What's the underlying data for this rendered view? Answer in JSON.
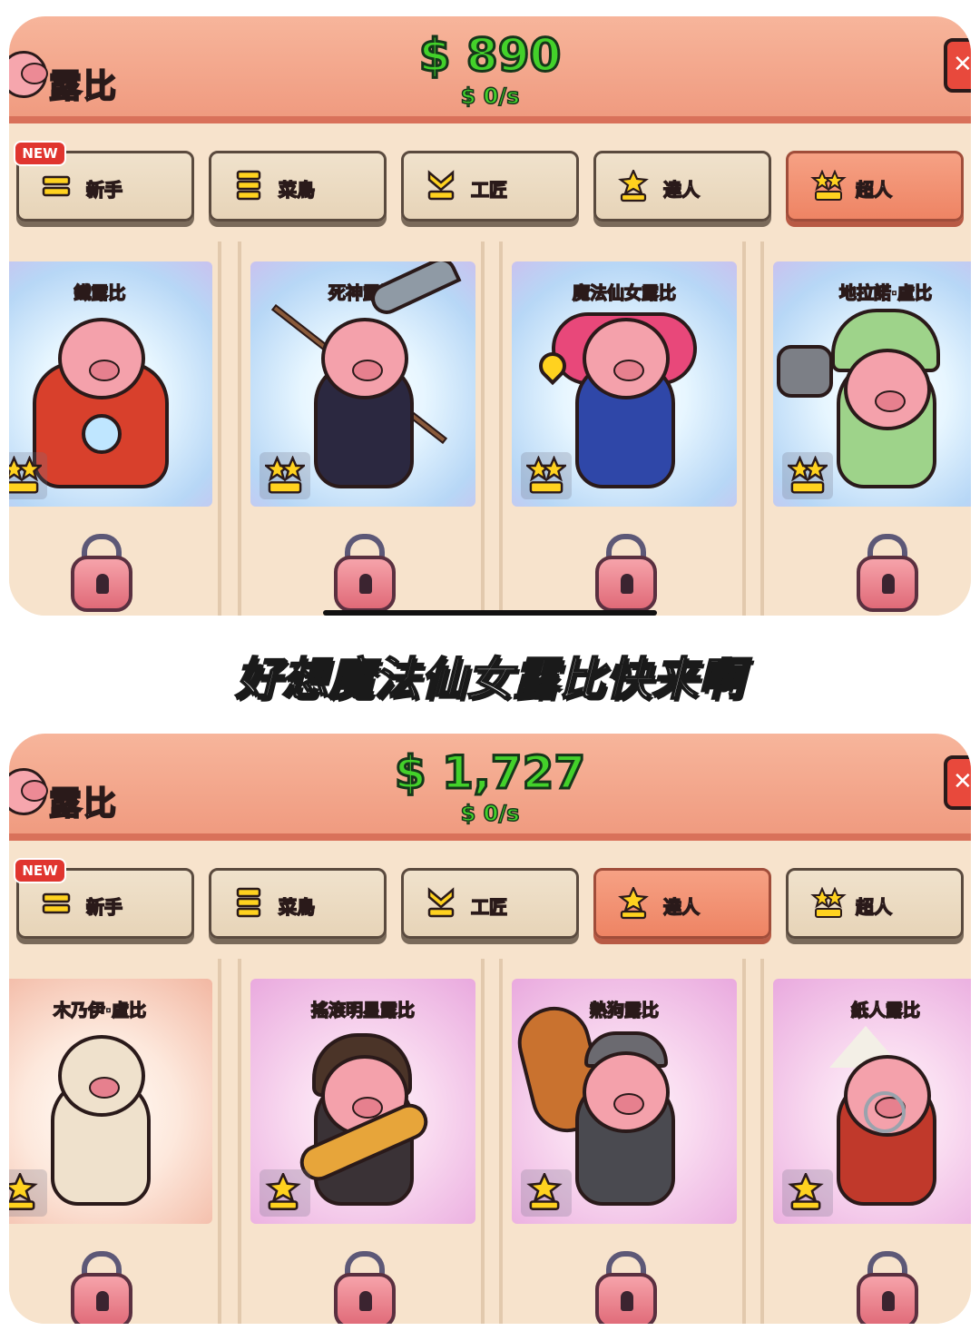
{
  "caption": "好想魔法仙女露比快来啊",
  "colors": {
    "money": "#43d12a",
    "topbar": "#f09b80",
    "active_tab": "#ee8464",
    "star": "#ffd21f"
  },
  "screens": [
    {
      "brand": "露比",
      "money": "$ 890",
      "rate": "$ 0/s",
      "new_badge": "NEW",
      "active_tab": "超人",
      "tabs": [
        {
          "label": "新手",
          "icon": "one-bar-rank-icon"
        },
        {
          "label": "菜鳥",
          "icon": "three-bar-rank-icon"
        },
        {
          "label": "工匠",
          "icon": "chevron-rank-icon"
        },
        {
          "label": "達人",
          "icon": "star-rank-icon"
        },
        {
          "label": "超人",
          "icon": "double-star-rank-icon"
        }
      ],
      "cards": [
        {
          "name": "鐵露比",
          "locked": true,
          "theme": "blue"
        },
        {
          "name": "死神露比",
          "locked": true,
          "theme": "blue"
        },
        {
          "name": "魔法仙女露比",
          "locked": true,
          "theme": "blue"
        },
        {
          "name": "地拉諾·盧比",
          "locked": true,
          "theme": "blue"
        }
      ]
    },
    {
      "brand": "露比",
      "money": "$ 1,727",
      "rate": "$ 0/s",
      "new_badge": "NEW",
      "active_tab": "達人",
      "tabs": [
        {
          "label": "新手",
          "icon": "one-bar-rank-icon"
        },
        {
          "label": "菜鳥",
          "icon": "three-bar-rank-icon"
        },
        {
          "label": "工匠",
          "icon": "chevron-rank-icon"
        },
        {
          "label": "達人",
          "icon": "star-rank-icon"
        },
        {
          "label": "超人",
          "icon": "double-star-rank-icon"
        }
      ],
      "cards": [
        {
          "name": "木乃伊·盧比",
          "locked": true,
          "theme": "peach"
        },
        {
          "name": "搖滾明星露比",
          "locked": true,
          "theme": "pink"
        },
        {
          "name": "熱狗露比",
          "locked": true,
          "theme": "pink"
        },
        {
          "name": "紙人露比",
          "locked": true,
          "theme": "pink"
        }
      ]
    }
  ]
}
